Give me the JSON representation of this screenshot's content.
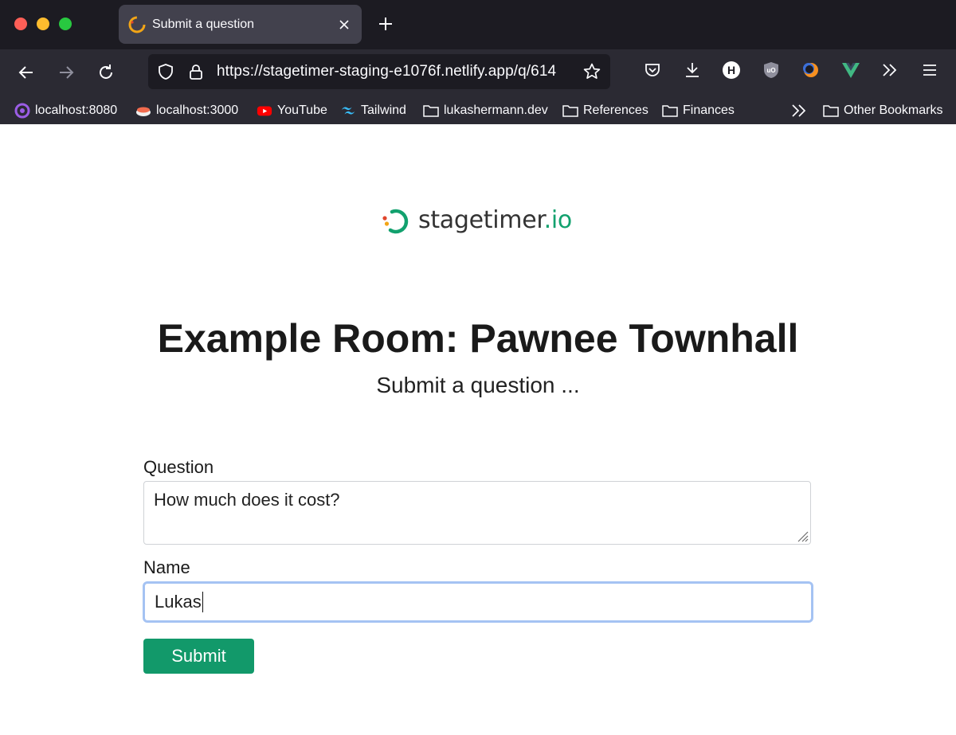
{
  "browser": {
    "tab_title": "Submit a question",
    "url": "https://stagetimer-staging-e1076f.netlify.app/q/614",
    "bookmarks": [
      {
        "label": "localhost:8080",
        "icon": "dev-icon"
      },
      {
        "label": "localhost:3000",
        "icon": "sushi-icon"
      },
      {
        "label": "YouTube",
        "icon": "youtube-icon"
      },
      {
        "label": "Tailwind",
        "icon": "tailwind-icon"
      },
      {
        "label": "lukashermann.dev",
        "icon": "folder-icon"
      },
      {
        "label": "References",
        "icon": "folder-icon"
      },
      {
        "label": "Finances",
        "icon": "folder-icon"
      }
    ],
    "other_bookmarks": "Other Bookmarks",
    "extension_h_label": "H",
    "extension_ublock_label": "uO"
  },
  "page": {
    "logo_text_main": "stagetimer",
    "logo_text_tld": ".io",
    "room_title": "Example Room: Pawnee Townhall",
    "subtitle": "Submit a question ...",
    "form": {
      "question_label": "Question",
      "question_value": "How much does it cost?",
      "name_label": "Name",
      "name_value": "Lukas",
      "submit_label": "Submit"
    }
  },
  "colors": {
    "brand_green": "#12a16e",
    "button_green": "#12996a",
    "focus_ring": "#a5c3f3",
    "chrome_dark": "#1c1b22",
    "toolbar": "#2b2a33"
  }
}
